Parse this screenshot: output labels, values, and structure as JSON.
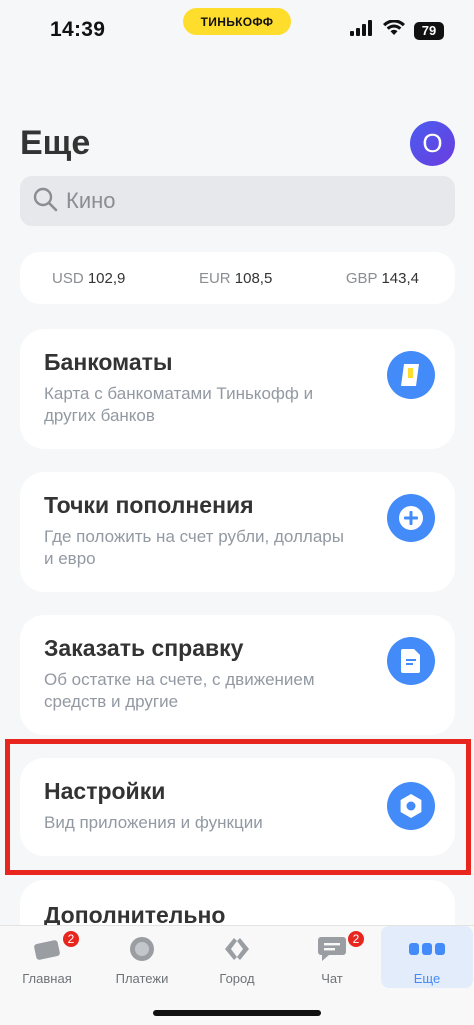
{
  "status_bar": {
    "time": "14:39",
    "brand": "ТИНЬКОФФ",
    "battery": "79"
  },
  "header": {
    "title": "Еще",
    "avatar_letter": "O"
  },
  "search": {
    "placeholder": "Кино"
  },
  "rates": [
    {
      "code": "USD",
      "value": "102,9"
    },
    {
      "code": "EUR",
      "value": "108,5"
    },
    {
      "code": "GBP",
      "value": "143,4"
    }
  ],
  "cards": [
    {
      "title": "Банкоматы",
      "subtitle": "Карта с банкоматами Тинькофф и других банков",
      "icon": "atm-icon"
    },
    {
      "title": "Точки пополнения",
      "subtitle": "Где положить на счет рубли, доллары и евро",
      "icon": "plus-icon"
    },
    {
      "title": "Заказать справку",
      "subtitle": "Об остатке на счете, с движением средств и другие",
      "icon": "document-icon"
    },
    {
      "title": "Настройки",
      "subtitle": "Вид приложения и функции",
      "icon": "settings-icon"
    },
    {
      "title": "Дополнительно"
    }
  ],
  "tabs": [
    {
      "label": "Главная",
      "badge": "2",
      "icon": "card-icon"
    },
    {
      "label": "Платежи",
      "icon": "payments-icon"
    },
    {
      "label": "Город",
      "icon": "city-icon"
    },
    {
      "label": "Чат",
      "badge": "2",
      "icon": "chat-icon"
    },
    {
      "label": "Еще",
      "icon": "more-icon",
      "active": true
    }
  ],
  "colors": {
    "accent": "#428bf9",
    "brand_yellow": "#ffdd2d",
    "highlight": "#e8261e",
    "background": "#f6f7f8"
  }
}
